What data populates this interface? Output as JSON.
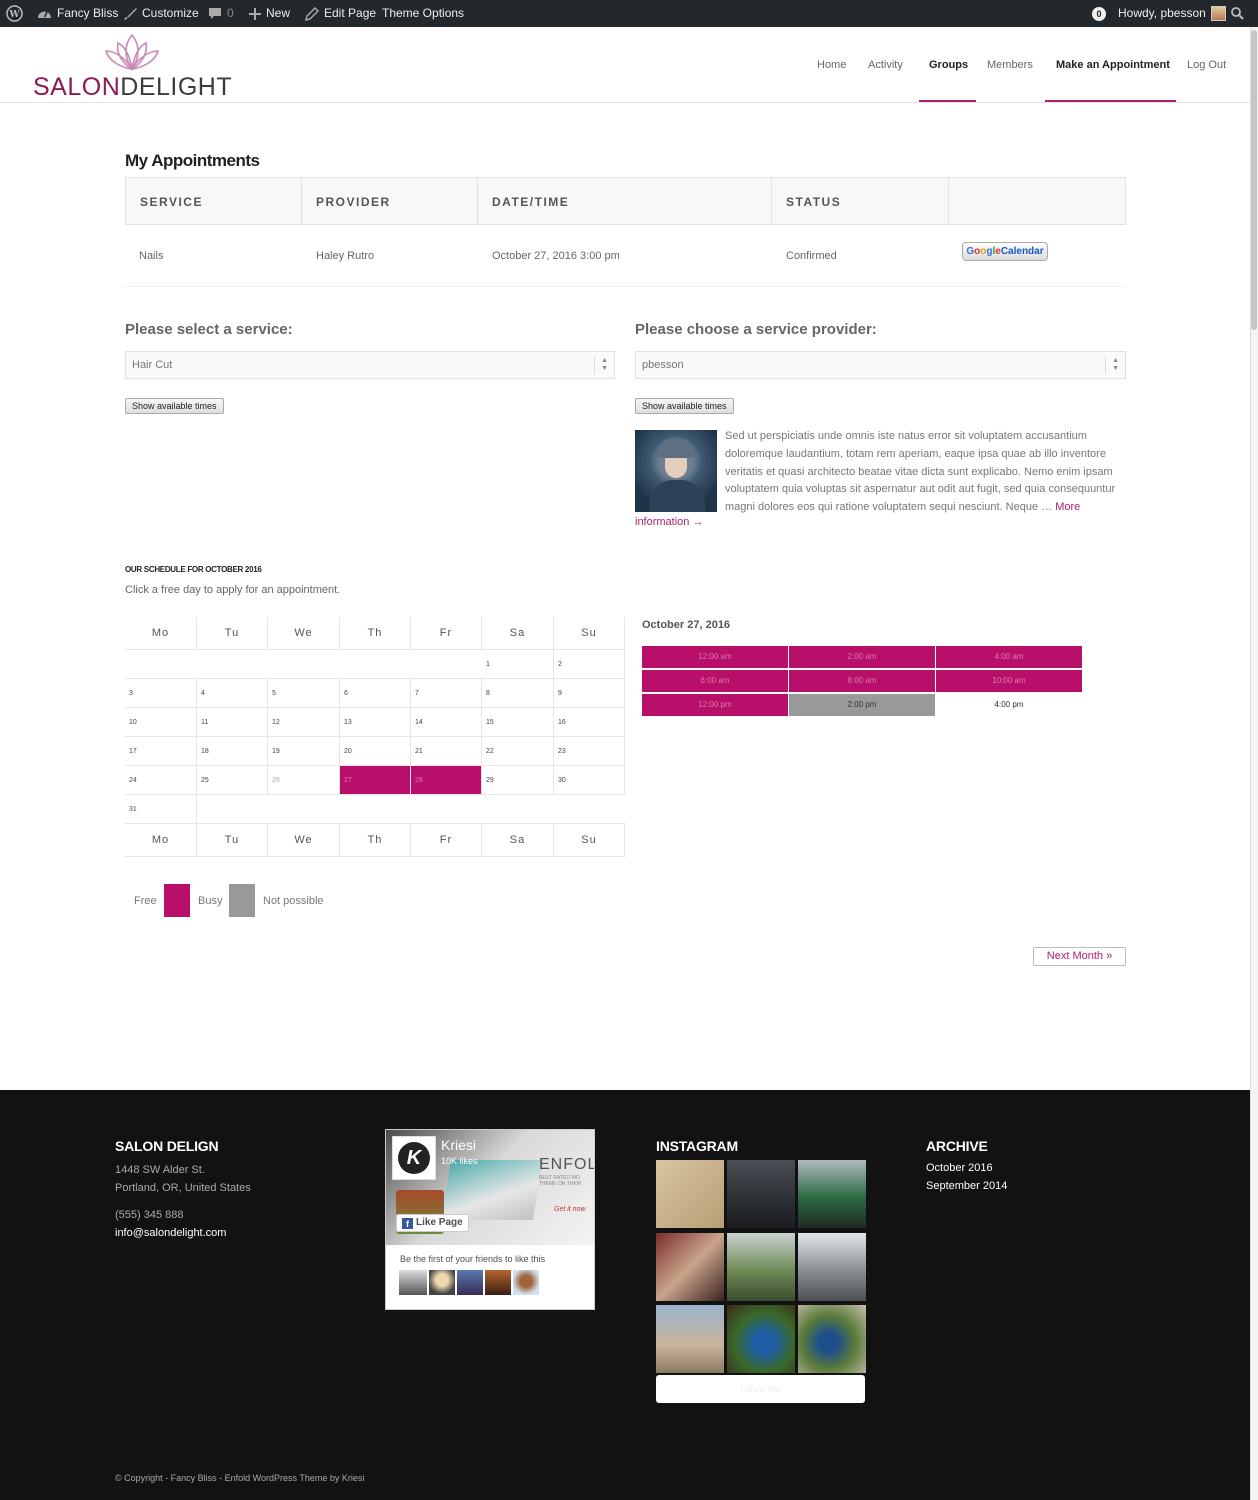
{
  "adminbar": {
    "site_name": "Fancy Bliss",
    "customize": "Customize",
    "comments_count": "0",
    "new": "New",
    "edit_page": "Edit Page",
    "theme_options": "Theme Options",
    "notifications_count": "0",
    "greeting": "Howdy, pbesson"
  },
  "logo": {
    "salon": "SALON",
    "delight": "DELIGHT"
  },
  "nav": {
    "items": [
      {
        "label": "Home"
      },
      {
        "label": "Activity"
      },
      {
        "label": "Groups"
      },
      {
        "label": "Members"
      },
      {
        "label": "Make an Appointment"
      },
      {
        "label": "Log Out"
      }
    ],
    "accent": "#b01e6f"
  },
  "appointments": {
    "title": "My Appointments",
    "headers": [
      "SERVICE",
      "PROVIDER",
      "DATE/TIME",
      "STATUS",
      ""
    ],
    "rows": [
      {
        "service": "Nails",
        "provider": "Haley Rutro",
        "datetime": "October 27, 2016 3:00 pm",
        "status": "Confirmed",
        "action": "Google Calendar"
      }
    ]
  },
  "service_select": {
    "label": "Please select a service:",
    "value": "Hair Cut",
    "button": "Show available times"
  },
  "provider_select": {
    "label": "Please choose a service provider:",
    "value": "pbesson",
    "button": "Show available times",
    "bio": "Sed ut perspiciatis unde omnis iste natus error sit voluptatem accusantium doloremque laudantium, totam rem aperiam, eaque ipsa quae ab illo inventore veritatis et quasi architecto beatae vitae dicta sunt explicabo. Nemo enim ipsam voluptatem quia voluptas sit aspernatur aut odit aut fugit, sed quia consequuntur magni dolores eos qui ratione voluptatem sequi nesciunt. Neque …",
    "more": "More",
    "info": "information →"
  },
  "schedule": {
    "title": "OUR SCHEDULE FOR OCTOBER 2016",
    "subtitle": "Click a free day to apply for an appointment.",
    "weekdays": [
      "Mo",
      "Tu",
      "We",
      "Th",
      "Fr",
      "Sa",
      "Su"
    ],
    "weeks": [
      [
        "",
        "",
        "",
        "",
        "",
        "1",
        "2"
      ],
      [
        "3",
        "4",
        "5",
        "6",
        "7",
        "8",
        "9"
      ],
      [
        "10",
        "11",
        "12",
        "13",
        "14",
        "15",
        "16"
      ],
      [
        "17",
        "18",
        "19",
        "20",
        "21",
        "22",
        "23"
      ],
      [
        "24",
        "25",
        "26",
        "27",
        "28",
        "29",
        "30"
      ],
      [
        "31",
        "",
        "",
        "",
        "",
        "",
        ""
      ]
    ],
    "busy_days": [
      "27",
      "28"
    ],
    "past_days": [
      "26"
    ],
    "busy_color": "#b80f6a",
    "not_possible_color": "#999999"
  },
  "day_slots": {
    "date": "October 27, 2016",
    "slots": [
      {
        "time": "12:00 am",
        "state": "busy"
      },
      {
        "time": "2:00 am",
        "state": "busy"
      },
      {
        "time": "4:00 am",
        "state": "busy"
      },
      {
        "time": "6:00 am",
        "state": "busy"
      },
      {
        "time": "8:00 am",
        "state": "busy"
      },
      {
        "time": "10:00 am",
        "state": "busy"
      },
      {
        "time": "12:00 pm",
        "state": "busy"
      },
      {
        "time": "2:00 pm",
        "state": "not-possible"
      },
      {
        "time": "4:00 pm",
        "state": "free"
      }
    ]
  },
  "legend": {
    "free": "Free",
    "busy": "Busy",
    "not_possible": "Not possible"
  },
  "next_month": "Next Month »",
  "footer": {
    "contact_title": "SALON DELIGN",
    "address1": "1448 SW Alder St.",
    "address2": "Portland, OR, United States",
    "phone": "(555) 345 888",
    "email": "info@salondelight.com",
    "fb": {
      "page": "Kriesi",
      "likes": "10K likes",
      "banner": "ENFOL",
      "banner_sub1": "BEST RATED WO",
      "banner_sub2": "THEME ON THEM",
      "get_it": "Get it now",
      "like_btn": "Like Page",
      "friends": "Be the first of your friends to like this"
    },
    "instagram_title": "INSTAGRAM",
    "instagram_btn": "Follow Me",
    "archive_title": "ARCHIVE",
    "archive": [
      "October 2016",
      "September 2014"
    ],
    "copyright": "© Copyright - Fancy Bliss - Enfold WordPress Theme by Kriesi"
  }
}
